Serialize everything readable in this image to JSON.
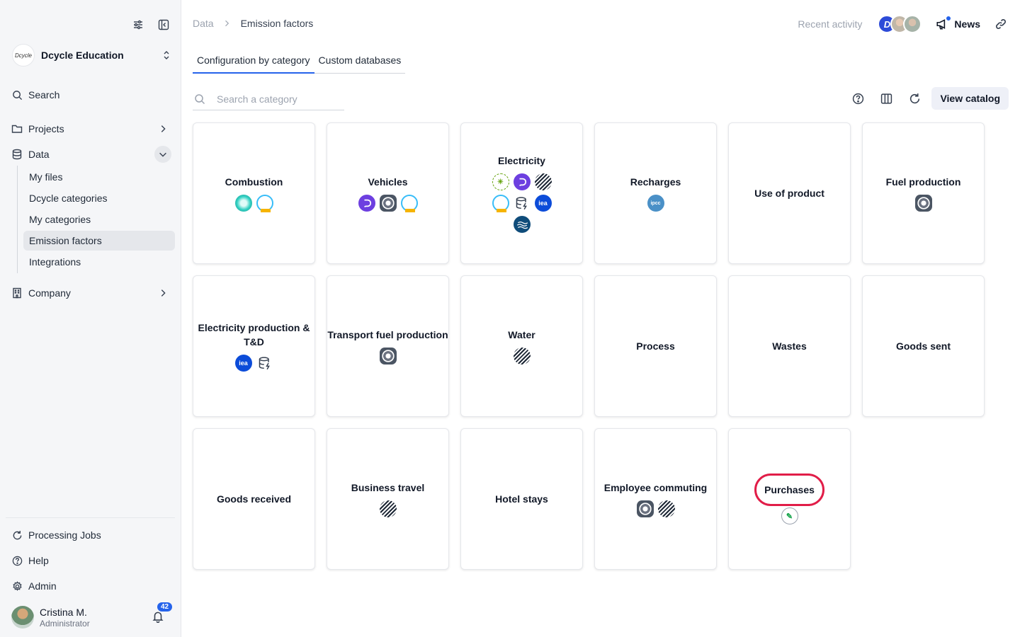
{
  "org": {
    "logo_text": "Dcycle",
    "name": "Dcycle Education"
  },
  "sidebar": {
    "search_label": "Search",
    "projects_label": "Projects",
    "data_label": "Data",
    "sub_items": [
      {
        "label": "My files"
      },
      {
        "label": "Dcycle categories"
      },
      {
        "label": "My categories"
      },
      {
        "label": "Emission factors",
        "active": true
      },
      {
        "label": "Integrations"
      }
    ],
    "company_label": "Company",
    "bottom_items": [
      {
        "label": "Processing Jobs"
      },
      {
        "label": "Help"
      },
      {
        "label": "Admin"
      }
    ]
  },
  "user": {
    "name": "Cristina M.",
    "role": "Administrator",
    "notifications": "42"
  },
  "breadcrumb": {
    "root": "Data",
    "current": "Emission factors"
  },
  "header": {
    "recent_activity": "Recent activity",
    "news": "News",
    "avatar_letter": "D"
  },
  "tabs": [
    {
      "label": "Configuration by category",
      "active": true
    },
    {
      "label": "Custom databases",
      "active": false
    }
  ],
  "search": {
    "placeholder": "Search a category"
  },
  "toolbar": {
    "view_catalog": "View catalog"
  },
  "cards": [
    {
      "title": "Combustion",
      "icons": [
        "cyan",
        "ring"
      ]
    },
    {
      "title": "Vehicles",
      "icons": [
        "purple",
        "stamp",
        "ring"
      ]
    },
    {
      "title": "Electricity",
      "icons": [
        "green",
        "purple",
        "stripe",
        "ring",
        "stack",
        "iea",
        "wave"
      ]
    },
    {
      "title": "Recharges",
      "icons": [
        "ipcc"
      ]
    },
    {
      "title": "Use of product",
      "icons": []
    },
    {
      "title": "Fuel production",
      "icons": [
        "stamp"
      ]
    },
    {
      "title": "Electricity production & T&D",
      "icons": [
        "iea",
        "stack"
      ]
    },
    {
      "title": "Transport fuel production",
      "icons": [
        "stamp"
      ]
    },
    {
      "title": "Water",
      "icons": [
        "stripe"
      ]
    },
    {
      "title": "Process",
      "icons": []
    },
    {
      "title": "Wastes",
      "icons": []
    },
    {
      "title": "Goods sent",
      "icons": []
    },
    {
      "title": "Goods received",
      "icons": []
    },
    {
      "title": "Business travel",
      "icons": [
        "stripe"
      ]
    },
    {
      "title": "Hotel stays",
      "icons": []
    },
    {
      "title": "Employee commuting",
      "icons": [
        "stamp",
        "stripe"
      ]
    },
    {
      "title": "Purchases",
      "icons": [
        "leaf"
      ],
      "highlighted": true
    }
  ],
  "icon_text": {
    "ipcc": "ipcc",
    "iea": "iea",
    "green": "✳",
    "leaf": "✎"
  },
  "colors": {
    "accent": "#2563eb",
    "highlight": "#e11d48",
    "badge": "#2563eb"
  }
}
